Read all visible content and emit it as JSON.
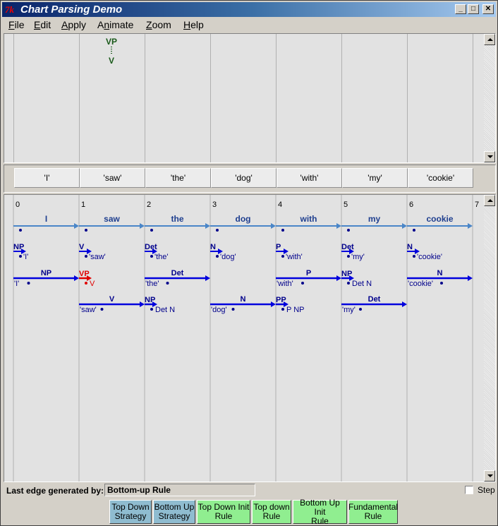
{
  "window": {
    "title": "Chart Parsing Demo",
    "icon_text": "7k",
    "controls": [
      "minimize",
      "maximize",
      "close"
    ]
  },
  "menu": [
    {
      "label": "File",
      "underline": "F",
      "rest": "ile"
    },
    {
      "label": "Edit",
      "underline": "E",
      "rest": "dit"
    },
    {
      "label": "Apply",
      "underline": "A",
      "rest": "pply"
    },
    {
      "label": "Animate",
      "underline": "n",
      "pre": "A",
      "rest": "imate"
    },
    {
      "label": "Zoom",
      "underline": "Z",
      "rest": "oom"
    },
    {
      "label": "Help",
      "underline": "H",
      "rest": "elp"
    }
  ],
  "tree": {
    "parent": "VP",
    "child": "V",
    "connector": "dotted"
  },
  "words": [
    "'I'",
    "'saw'",
    "'the'",
    "'dog'",
    "'with'",
    "'my'",
    "'cookie'"
  ],
  "chart": {
    "positions": [
      "0",
      "1",
      "2",
      "3",
      "4",
      "5",
      "6",
      "7"
    ],
    "colors": {
      "leaf": "#4a86c8",
      "edge": "#0000dd",
      "selected": "#e00000",
      "label": "#00008b",
      "tree": "#1a5a1a"
    },
    "leaf_edges": [
      {
        "label": "I",
        "start": 0,
        "end": 1
      },
      {
        "label": "saw",
        "start": 1,
        "end": 2
      },
      {
        "label": "the",
        "start": 2,
        "end": 3
      },
      {
        "label": "dog",
        "start": 3,
        "end": 4
      },
      {
        "label": "with",
        "start": 4,
        "end": 5
      },
      {
        "label": "my",
        "start": 5,
        "end": 6
      },
      {
        "label": "cookie",
        "start": 6,
        "end": 7
      }
    ],
    "predicted_edges": [
      {
        "label": "NP",
        "start": 0,
        "rhs": "'I'"
      },
      {
        "label": "V",
        "start": 1,
        "rhs": "'saw'"
      },
      {
        "label": "Det",
        "start": 2,
        "rhs": "'the'"
      },
      {
        "label": "N",
        "start": 3,
        "rhs": "'dog'"
      },
      {
        "label": "P",
        "start": 4,
        "rhs": "'with'"
      },
      {
        "label": "Det",
        "start": 5,
        "rhs": "'my'"
      },
      {
        "label": "N",
        "start": 6,
        "rhs": "'cookie'"
      }
    ],
    "row3_edges": [
      {
        "kind": "complete",
        "label": "NP",
        "start": 0,
        "end": 1,
        "rhs": "'I'"
      },
      {
        "kind": "selected",
        "label": "VP",
        "start": 1,
        "rhs": "V"
      },
      {
        "kind": "complete",
        "label": "Det",
        "start": 2,
        "end": 3,
        "rhs": "'the'"
      },
      {
        "kind": "complete",
        "label": "P",
        "start": 4,
        "end": 5,
        "rhs": "'with'"
      },
      {
        "kind": "predict",
        "label": "NP",
        "start": 5,
        "rhs": "Det N"
      },
      {
        "kind": "complete",
        "label": "N",
        "start": 6,
        "end": 7,
        "rhs": "'cookie'"
      }
    ],
    "row4_edges": [
      {
        "kind": "complete",
        "label": "V",
        "start": 1,
        "end": 2,
        "rhs": "'saw'"
      },
      {
        "kind": "predict",
        "label": "NP",
        "start": 2,
        "rhs": "Det N"
      },
      {
        "kind": "complete",
        "label": "N",
        "start": 3,
        "end": 4,
        "rhs": "'dog'"
      },
      {
        "kind": "predict",
        "label": "PP",
        "start": 4,
        "rhs": "P NP"
      },
      {
        "kind": "complete",
        "label": "Det",
        "start": 5,
        "end": 6,
        "rhs": "'my'"
      }
    ]
  },
  "status": {
    "label": "Last edge generated by:",
    "value": "Bottom-up Rule",
    "step_label": "Step",
    "step_checked": false
  },
  "buttons": [
    {
      "line1": "Top Down",
      "line2": "Strategy",
      "color": "#8fbcd0"
    },
    {
      "line1": "Bottom Up",
      "line2": "Strategy",
      "color": "#8fbcd0"
    },
    {
      "line1": "Top Down Init",
      "line2": "Rule",
      "color": "#90ee90"
    },
    {
      "line1": "Top down",
      "line2": "Rule",
      "color": "#90ee90"
    },
    {
      "line1": "Bottom Up Init",
      "line2": "Rule",
      "color": "#90ee90"
    },
    {
      "line1": "Fundamental",
      "line2": "Rule",
      "color": "#90ee90"
    }
  ]
}
